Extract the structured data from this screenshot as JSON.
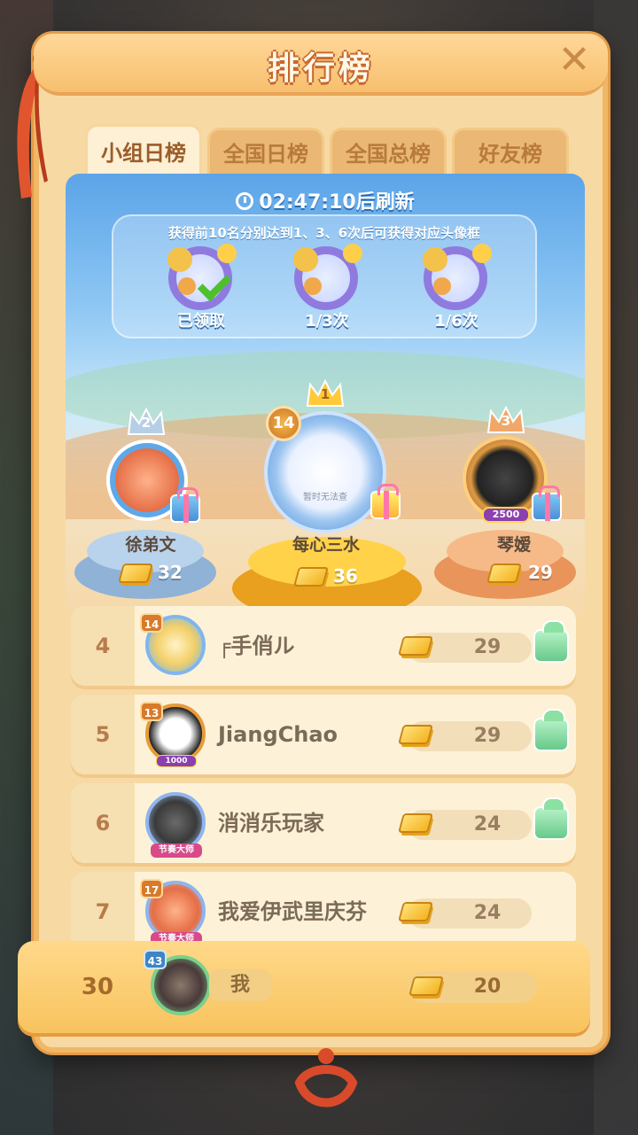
{
  "header": {
    "title": "排行榜"
  },
  "tabs": [
    {
      "label": "小组日榜",
      "active": true
    },
    {
      "label": "全国日榜",
      "active": false
    },
    {
      "label": "全国总榜",
      "active": false
    },
    {
      "label": "好友榜",
      "active": false
    }
  ],
  "board": {
    "refresh_text": "02:47:10后刷新",
    "reward_desc": "获得前10名分别达到1、3、6次后可获得对应头像框",
    "frames": [
      {
        "label": "已领取",
        "claimed": true
      },
      {
        "label": "1/3次",
        "claimed": false
      },
      {
        "label": "1/6次",
        "claimed": false
      }
    ]
  },
  "podium": {
    "first": {
      "rank": "1",
      "name": "每心三水",
      "score": "36",
      "level": "14",
      "avatar_text": "暂时无法查"
    },
    "second": {
      "rank": "2",
      "name": "徐弟文",
      "score": "32"
    },
    "third": {
      "rank": "3",
      "name": "琴嫒",
      "score": "29",
      "badge": "2500"
    }
  },
  "rows": [
    {
      "rank": "4",
      "name": "╒手俏ル",
      "score": "29",
      "level": "14",
      "gift": true
    },
    {
      "rank": "5",
      "name": "JiangChao",
      "score": "29",
      "level": "13",
      "gift": true,
      "frame_badge": "1000"
    },
    {
      "rank": "6",
      "name": "消消乐玩家",
      "score": "24",
      "gift": true,
      "frame_badge": "节奏大师"
    },
    {
      "rank": "7",
      "name": "我爱伊武里庆芬",
      "score": "24",
      "level": "17",
      "gift": false,
      "frame_badge": "节奏大师"
    }
  ],
  "me": {
    "rank": "30",
    "name": "我",
    "score": "20",
    "level": "43"
  },
  "colors": {
    "accent": "#f0b765",
    "sky": "#5ba4e8",
    "gold": "#f4b220"
  }
}
